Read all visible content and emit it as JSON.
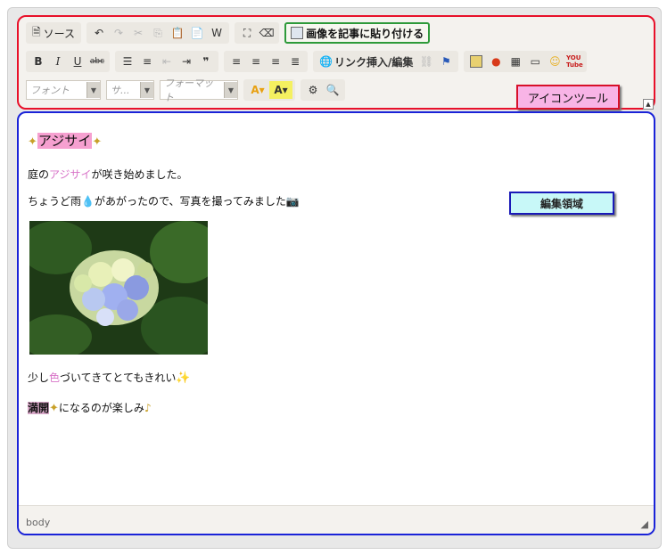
{
  "toolbar": {
    "source_label": "ソース",
    "paste_image_label": "画像を記事に貼り付ける",
    "link_label": "リンク挿入/編集",
    "font_placeholder": "フォント",
    "size_placeholder": "サ...",
    "format_placeholder": "フォーマット",
    "icon_tool_callout": "アイコンツール"
  },
  "editor": {
    "callout": "編集領域",
    "heading": "アジサイ",
    "line1_pre": "庭の",
    "line1_pink": "アジサイ",
    "line1_post": "が咲き始めました。",
    "line2_pre": "ちょうど雨",
    "line2_post": "があがったので、写真を撮ってみました",
    "line3_pre": "少し",
    "line3_pink": "色",
    "line3_post": "づいてきてとてもきれい",
    "line4_hl": "満開",
    "line4_post": "になるのが楽しみ"
  },
  "status": {
    "path": "body"
  },
  "colors": {
    "toolbar_border": "#e8102a",
    "editor_border": "#1a23d8",
    "paste_border": "#2e9a3a",
    "pink_text": "#d874c8",
    "heading_highlight": "#f6a0d0"
  }
}
